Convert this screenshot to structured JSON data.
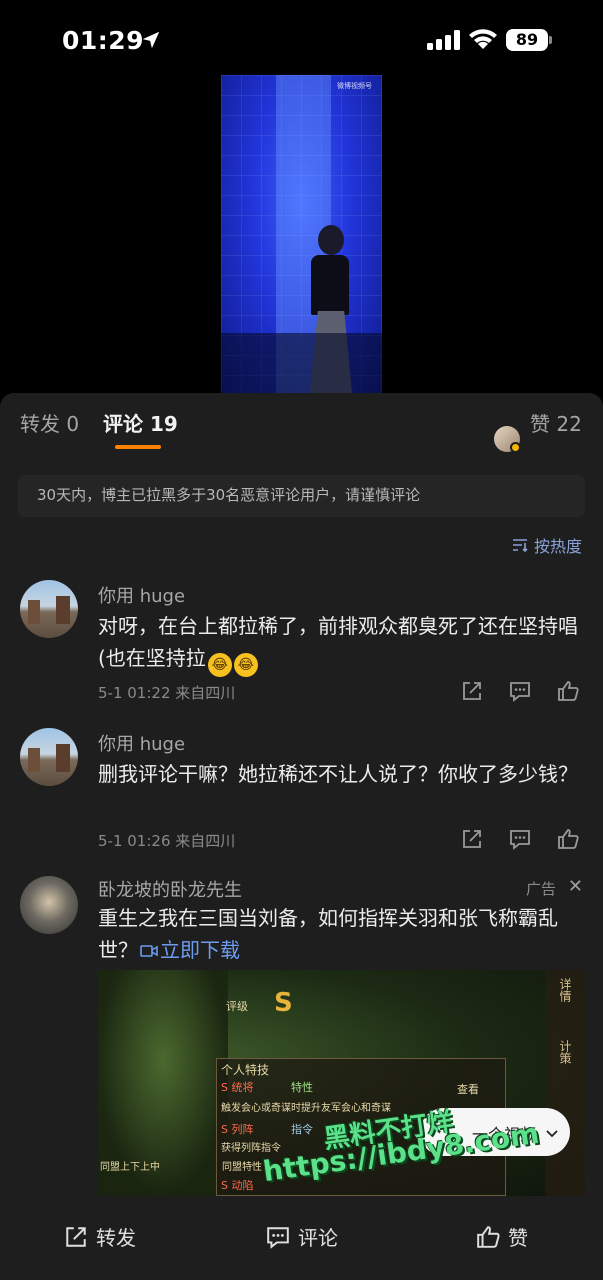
{
  "status_bar": {
    "time": "01:29",
    "location_icon": "location-arrow-icon",
    "signal_icon": "cellular-signal-icon",
    "wifi_icon": "wifi-icon",
    "battery": "89"
  },
  "video": {
    "watermark_text": "微博视频号"
  },
  "tabs": {
    "repost_label": "转发 0",
    "comment_label": "评论 19",
    "like_label": "赞 22",
    "accent_color": "#ff8200"
  },
  "notice": "30天内，博主已拉黑多于30名恶意评论用户，请谨慎评论",
  "sort_label": "按热度",
  "comments": [
    {
      "username": "你用 huge",
      "text": "对呀，在台上都拉稀了，前排观众都臭死了还在坚持唱 (也在坚持拉",
      "meta": "5-1 01:22  来自四川"
    },
    {
      "username": "你用 huge",
      "text": "删我评论干嘛？她拉稀还不让人说了？你收了多少钱？",
      "meta": "5-1 01:26  来自四川"
    }
  ],
  "ad": {
    "username": "卧龙坡的卧龙先生",
    "label": "广告",
    "close": "✕",
    "text": "重生之我在三国当刘备，如何指挥关羽和张飞称霸乱世？",
    "download_link": "立即下载",
    "game": {
      "grade": "S",
      "rank_label": "评级",
      "panel_title": "个人特技",
      "skill1": "S 统将",
      "skill1_tag": "特性",
      "skill1_desc": "触发会心或奇谋时提升友军会心和奇谋",
      "skill2": "S 列阵",
      "skill2_tag": "指令",
      "skill2_desc": "获得列阵指令",
      "skill3": "S 动陷",
      "view": "查看",
      "side1": "详情",
      "side2": "计策",
      "side_left1": "同盟上下上中",
      "side_left2": "同盟特性"
    },
    "more_button": "一个视频"
  },
  "watermark": {
    "line1": "黑料不打烊",
    "line2": "https://ibdy8.com"
  },
  "bottom_bar": {
    "repost": "转发",
    "comment": "评论",
    "like": "赞"
  },
  "colors": {
    "panel_bg": "#1e1e1e",
    "link": "#6d9cf0",
    "sort": "#8aa2d8"
  }
}
